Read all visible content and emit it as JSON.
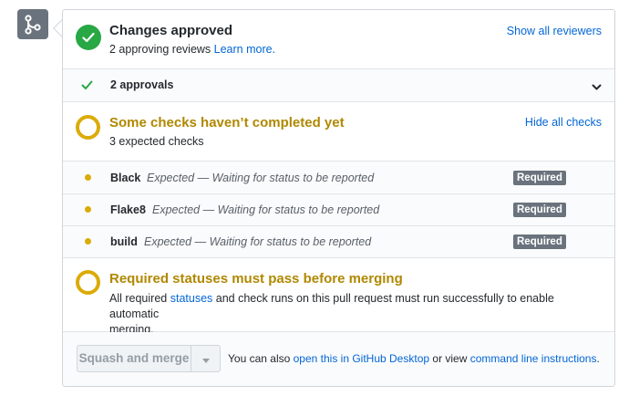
{
  "approved": {
    "title": "Changes approved",
    "desc_prefix": "2 approving reviews",
    "desc_link": "Learn more.",
    "toggle": "Show all reviewers"
  },
  "approvals": {
    "label": "2 approvals"
  },
  "checks": {
    "title": "Some checks haven’t completed yet",
    "desc": "3 expected checks",
    "toggle": "Hide all checks",
    "items": [
      {
        "name": "Black",
        "status": "Expected — Waiting for status to be reported",
        "badge": "Required"
      },
      {
        "name": "Flake8",
        "status": "Expected — Waiting for status to be reported",
        "badge": "Required"
      },
      {
        "name": "build",
        "status": "Expected — Waiting for status to be reported",
        "badge": "Required"
      }
    ]
  },
  "required": {
    "title": "Required statuses must pass before merging",
    "desc_prefix": "All required",
    "desc_link": "statuses",
    "desc_line1_rest": "and check runs on this pull request must run successfully to enable automatic",
    "desc_line2": "merging."
  },
  "footer": {
    "button": "Squash and merge",
    "text_prefix": "You can also",
    "link_desktop": "open this in GitHub Desktop",
    "text_mid": "or view",
    "link_cli": "command line instructions",
    "text_end": "."
  },
  "colors": {
    "success": "#28a745",
    "pending": "#dbab09",
    "link": "#0366d6"
  },
  "icons": [
    "git-merge-icon",
    "check-circle-icon",
    "check-icon",
    "chevron-down-icon",
    "pending-ring-icon",
    "triangle-down-icon"
  ]
}
